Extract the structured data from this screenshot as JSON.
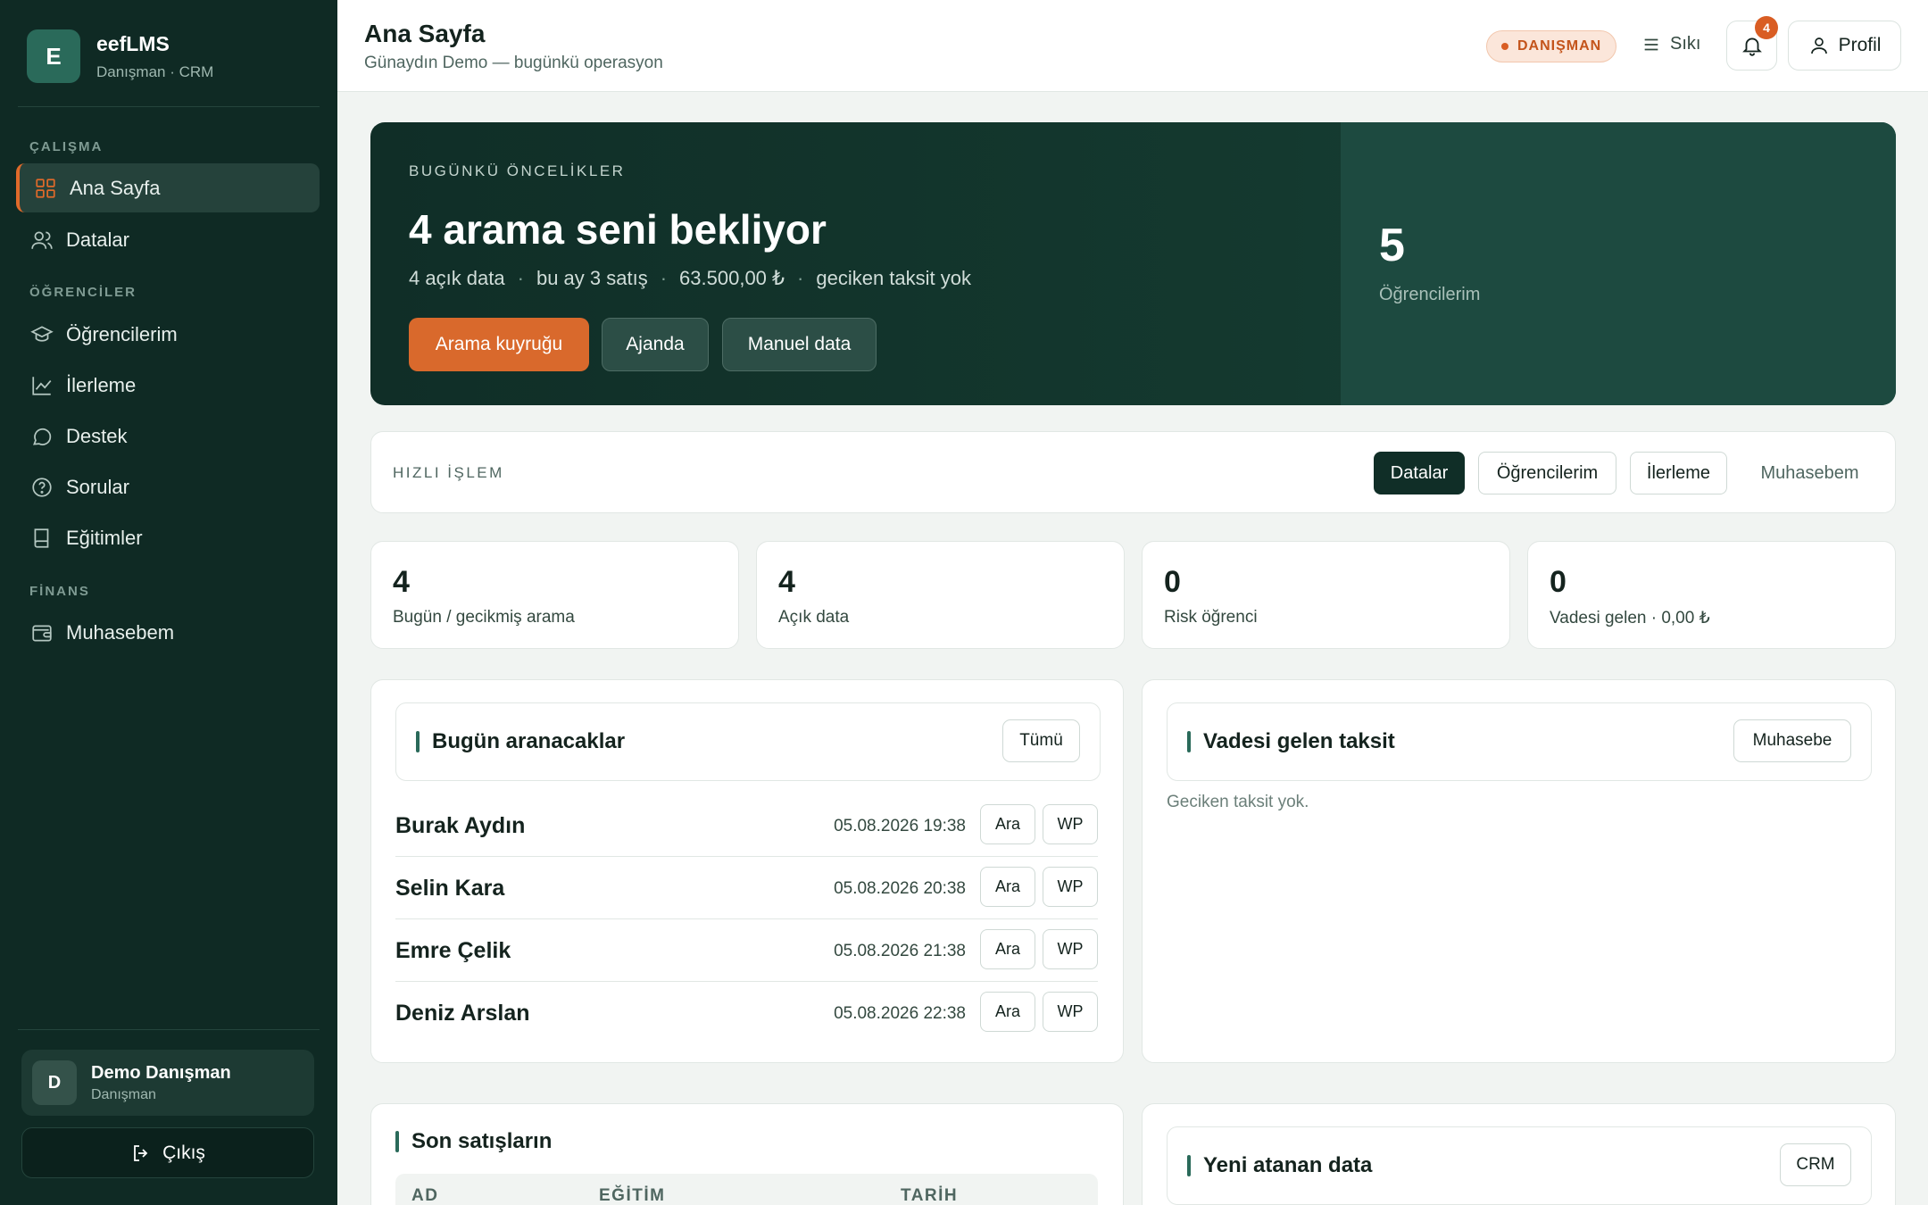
{
  "brand": {
    "logo_letter": "E",
    "name": "eefLMS",
    "subtitle": "Danışman · CRM"
  },
  "sidebar": {
    "sections": [
      {
        "title": "ÇALIŞMA"
      },
      {
        "title": "ÖĞRENCİLER"
      },
      {
        "title": "FİNANS"
      }
    ],
    "items": [
      {
        "label": "Ana Sayfa",
        "icon": "grid-icon",
        "active": true
      },
      {
        "label": "Datalar",
        "icon": "users-icon"
      },
      {
        "label": "Öğrencilerim",
        "icon": "graduation-cap-icon"
      },
      {
        "label": "İlerleme",
        "icon": "chart-line-icon"
      },
      {
        "label": "Destek",
        "icon": "chat-bubble-icon"
      },
      {
        "label": "Sorular",
        "icon": "help-circle-icon"
      },
      {
        "label": "Eğitimler",
        "icon": "book-icon"
      },
      {
        "label": "Muhasebem",
        "icon": "wallet-icon"
      }
    ],
    "user": {
      "avatar_letter": "D",
      "name": "Demo Danışman",
      "role": "Danışman"
    },
    "logout_label": "Çıkış"
  },
  "header": {
    "title": "Ana Sayfa",
    "subtitle": "Günaydın Demo — bugünkü operasyon",
    "role_badge": "DANIŞMAN",
    "density_label": "Sıkı",
    "notification_count": "4",
    "profile_label": "Profil"
  },
  "hero": {
    "kicker": "BUGÜNKÜ ÖNCELİKLER",
    "title": "4 arama seni bekliyor",
    "stats": [
      "4 açık data",
      "bu ay 3 satış",
      "63.500,00 ₺",
      "geciken taksit yok"
    ],
    "separator": "·",
    "buttons": {
      "primary": "Arama kuyruğu",
      "agenda": "Ajanda",
      "manual": "Manuel data"
    },
    "side_value": "5",
    "side_label": "Öğrencilerim"
  },
  "quick_actions": {
    "label": "HIZLI İŞLEM",
    "chips": [
      "Datalar",
      "Öğrencilerim",
      "İlerleme",
      "Muhasebem"
    ]
  },
  "stats": [
    {
      "value": "4",
      "label": "Bugün / gecikmiş arama"
    },
    {
      "value": "4",
      "label": "Açık data"
    },
    {
      "value": "0",
      "label": "Risk öğrenci"
    },
    {
      "value": "0",
      "label": "Vadesi gelen · 0,00 ₺"
    }
  ],
  "calls_panel": {
    "title": "Bugün aranacaklar",
    "all_button": "Tümü",
    "call_label": "Ara",
    "wp_label": "WP",
    "rows": [
      {
        "name": "Burak Aydın",
        "date": "05.08.2026 19:38"
      },
      {
        "name": "Selin Kara",
        "date": "05.08.2026 20:38"
      },
      {
        "name": "Emre Çelik",
        "date": "05.08.2026 21:38"
      },
      {
        "name": "Deniz Arslan",
        "date": "05.08.2026 22:38"
      }
    ]
  },
  "installments_panel": {
    "title": "Vadesi gelen taksit",
    "button": "Muhasebe",
    "empty": "Geciken taksit yok."
  },
  "sales_panel": {
    "title": "Son satışların",
    "columns": [
      "AD",
      "EĞİTİM",
      "TARİH"
    ]
  },
  "new_data_panel": {
    "title": "Yeni atanan data",
    "button": "CRM"
  },
  "colors": {
    "accent": "#d9692c",
    "sidebar": "#0f2a24",
    "hero": "#102e27"
  }
}
